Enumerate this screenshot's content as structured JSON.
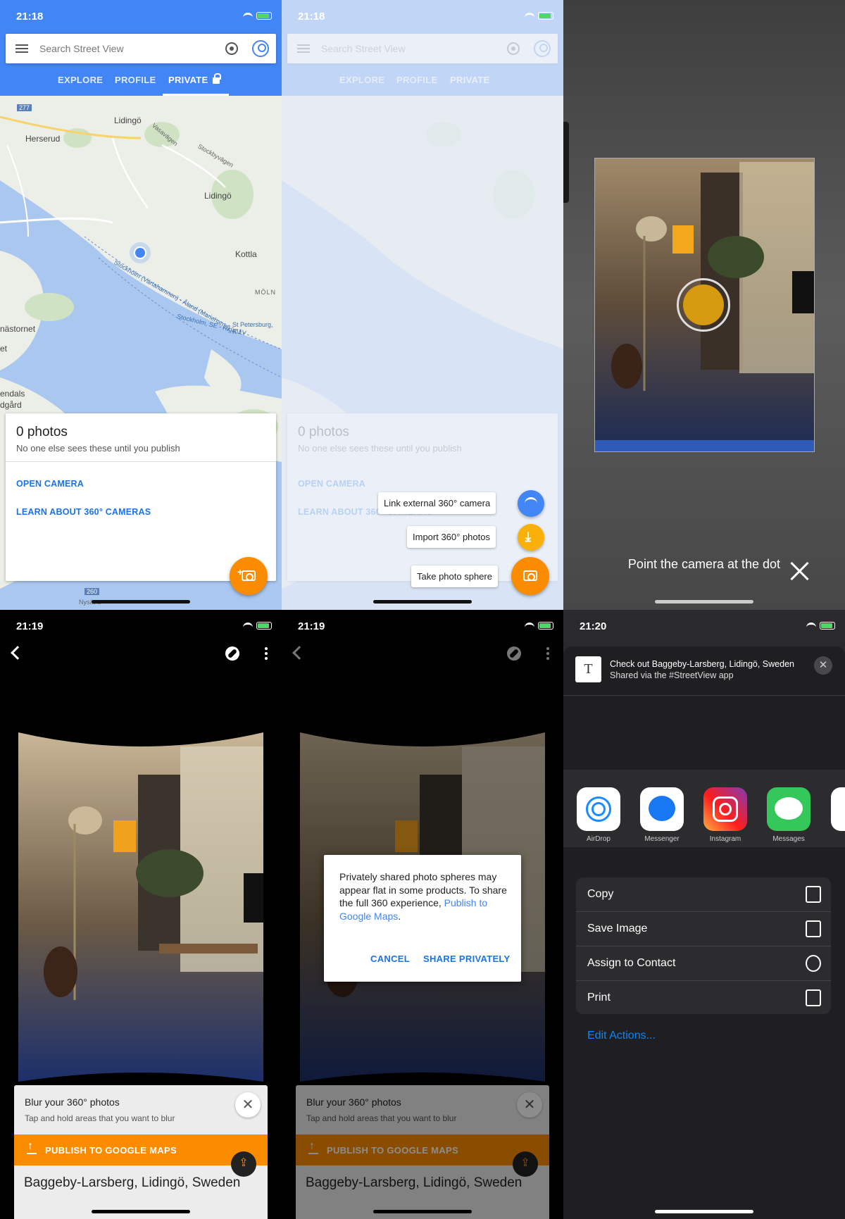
{
  "status": {
    "p1_time": "21:18",
    "p2_time": "21:18",
    "p4_time": "21:19",
    "p5_time": "21:19",
    "p6_time": "21:20"
  },
  "search": {
    "placeholder": "Search Street View"
  },
  "tabs": [
    "EXPLORE",
    "PROFILE",
    "PRIVATE"
  ],
  "map_labels": {
    "hwy277": "277",
    "lidingo1": "Lidingö",
    "herserud": "Herserud",
    "lidingo2": "Lidingö",
    "kottla": "Kottla",
    "moln": "MÖLN",
    "nastornet": "nästornet",
    "et": "et",
    "endals": "endals",
    "dgard": "dgård",
    "hwy260": "260",
    "nysatra": "Nysätra",
    "route1": "Stockholm (Värtahamnen) - Åland (Mariehamn)",
    "route2": "Stockholm, SE - Riga, LV",
    "route3": "St Petersburg, RU",
    "vasavagen": "Vasavägen",
    "stockbyvagen": "Stockbyvägen"
  },
  "card": {
    "count": "0 photos",
    "subtitle": "No one else sees these until you publish",
    "open_camera": "OPEN CAMERA",
    "learn": "LEARN ABOUT 360° CAMERAS"
  },
  "speed_dial": {
    "link": "Link external 360° camera",
    "import": "Import 360° photos",
    "take": "Take photo sphere"
  },
  "camera": {
    "instruction": "Point the camera at the dot"
  },
  "viewer": {
    "blur_title": "Blur your 360° photos",
    "blur_sub": "Tap and hold areas that you want to blur",
    "publish": "PUBLISH TO GOOGLE MAPS",
    "place": "Baggeby-Larsberg, Lidingö, Sweden",
    "close_glyph": "✕"
  },
  "dialog": {
    "message": "Privately shared photo spheres may appear flat in some products. To share the full 360 experience,",
    "link": "Publish to Google Maps",
    "period": ".",
    "cancel": "CANCEL",
    "share": "SHARE PRIVATELY"
  },
  "share_sheet": {
    "line1": "Check out Baggeby-Larsberg, Lidingö, Sweden",
    "line2": "Shared via the #StreetView app",
    "close_glyph": "✕",
    "apps": [
      "AirDrop",
      "Messenger",
      "Instagram",
      "Messages"
    ],
    "actions": [
      "Copy",
      "Save Image",
      "Assign to Contact",
      "Print"
    ],
    "edit": "Edit Actions..."
  },
  "colors": {
    "google_blue": "#4285f4",
    "fab_orange": "#fb8c00",
    "link_blue": "#1a73e8",
    "ios_blue": "#0a84ff"
  }
}
